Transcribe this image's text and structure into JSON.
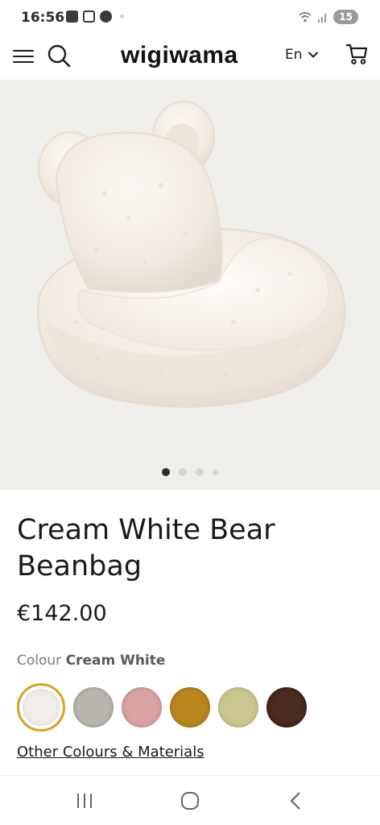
{
  "status_bar": {
    "time": "16:56",
    "battery": "15",
    "icons": [
      "alert-icon",
      "screenshot-icon",
      "media-icon",
      "notification-dot",
      "wifi-icon",
      "signal-icon"
    ]
  },
  "header": {
    "logo": "wigiwama",
    "language": "En"
  },
  "gallery": {
    "image": "cream-bear-beanbag-photo",
    "dots": [
      true,
      false,
      false,
      false
    ]
  },
  "product": {
    "title": "Cream White Bear Beanbag",
    "price": "€142.00",
    "colour_label": "Colour",
    "colour_value": "Cream White",
    "swatches": [
      {
        "name": "cream-white",
        "color": "#f1eeea",
        "selected": true
      },
      {
        "name": "grey",
        "color": "#b9b5af",
        "selected": false
      },
      {
        "name": "pink",
        "color": "#d9a2a3",
        "selected": false
      },
      {
        "name": "mustard",
        "color": "#b9861e",
        "selected": false
      },
      {
        "name": "olive",
        "color": "#c9c78f",
        "selected": false
      },
      {
        "name": "brown",
        "color": "#4b2a20",
        "selected": false
      }
    ],
    "other_link": "Other Colours & Materials"
  },
  "colors": {
    "accent": "#d9a21a",
    "hero_bg": "#efeeea"
  }
}
